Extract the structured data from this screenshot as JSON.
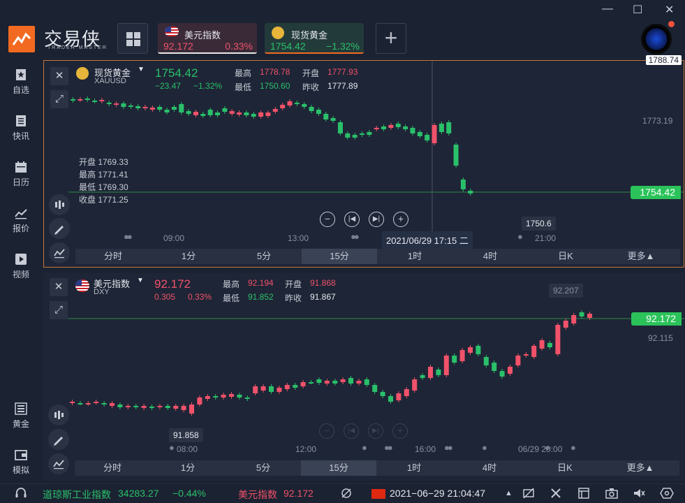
{
  "app": {
    "brand": "交易侠",
    "brand_sub": "TRADER MASTER"
  },
  "tabs": [
    {
      "name": "美元指数",
      "price": "92.172",
      "change": "0.33%",
      "price_color": "#f0526a",
      "change_color": "#f0526a"
    },
    {
      "name": "现货黄金",
      "price": "1754.42",
      "change": "−1.32%",
      "price_color": "#2ac06a",
      "change_color": "#2ac06a"
    }
  ],
  "sidebar": {
    "items": [
      {
        "label": "自选",
        "icon": "star-bookmark-icon"
      },
      {
        "label": "快讯",
        "icon": "news-list-icon"
      },
      {
        "label": "日历",
        "icon": "calendar-icon"
      },
      {
        "label": "报价",
        "icon": "trend-line-icon"
      },
      {
        "label": "视频",
        "icon": "play-icon"
      },
      {
        "label": "黄金",
        "icon": "gold-bar-icon"
      },
      {
        "label": "模拟",
        "icon": "wallet-icon"
      }
    ]
  },
  "panel1": {
    "name": "现货黄金",
    "symbol": "XAUUSD",
    "price": "1754.42",
    "change": "−23.47",
    "change_pct": "−1.32%",
    "high_label": "最高",
    "high": "1778.78",
    "low_label": "最低",
    "low": "1750.60",
    "open_label": "开盘",
    "open": "1777.93",
    "prev_label": "昨收",
    "prev_close": "1777.89",
    "ohlc": {
      "open": "开盘 1769.33",
      "high": "最高 1771.41",
      "low": "最低 1769.30",
      "close": "收盘 1771.25"
    },
    "axis_top": "1788.74",
    "axis_mid": "1773.19",
    "tag": "1754.42",
    "low_marker": "1750.6",
    "crosshair_time": "2021/06/29 17:15 二",
    "times": [
      "09:00",
      "13:00",
      "21:00"
    ]
  },
  "panel2": {
    "name": "美元指数",
    "symbol": "DXY",
    "price": "92.172",
    "change": "0.305",
    "change_pct": "0.33%",
    "high_label": "最高",
    "high": "92.194",
    "low_label": "最低",
    "low": "91.852",
    "open_label": "开盘",
    "open": "91.868",
    "prev_label": "昨收",
    "prev_close": "91.867",
    "axis_mid": "92.115",
    "tag": "92.172",
    "high_marker": "92.207",
    "low_marker": "91.858",
    "times": [
      "08:00",
      "12:00",
      "16:00",
      "06/29 20:00"
    ]
  },
  "periods": [
    "分时",
    "1分",
    "5分",
    "15分",
    "1时",
    "4时",
    "日K",
    "更多▲"
  ],
  "active_period": "15分",
  "statusbar": {
    "dow_name": "道琼斯工业指数",
    "dow_value": "34283.27",
    "dow_change": "−0.44%",
    "usd_name": "美元指数",
    "usd_value": "92.172",
    "datetime": "2021−06−29 21:04:47"
  },
  "colors": {
    "up": "#f0526a",
    "down": "#2ac06a",
    "accent": "#f26a21",
    "panel_border": "#c8753a"
  },
  "chart_data": [
    {
      "type": "candlestick",
      "symbol": "XAUUSD",
      "x": [
        "09:00",
        "13:00",
        "17:15",
        "21:00"
      ],
      "ohlc_at_crosshair": {
        "open": 1769.33,
        "high": 1771.41,
        "low": 1769.3,
        "close": 1771.25
      },
      "last": 1754.42,
      "session_low": 1750.6,
      "ylim": [
        1750,
        1789
      ]
    },
    {
      "type": "candlestick",
      "symbol": "DXY",
      "x": [
        "08:00",
        "12:00",
        "16:00",
        "06/29 20:00"
      ],
      "last": 92.172,
      "session_high": 92.207,
      "session_low": 91.858
    }
  ]
}
